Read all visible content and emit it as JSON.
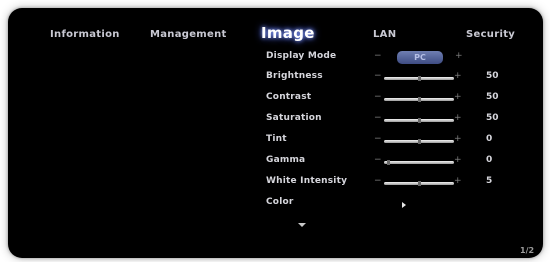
{
  "tabs": [
    {
      "label": "Information"
    },
    {
      "label": "Management"
    },
    {
      "label": "Image"
    },
    {
      "label": "LAN"
    },
    {
      "label": "Security"
    }
  ],
  "active_tab": "Image",
  "rows": {
    "display_mode": {
      "label": "Display Mode",
      "minus": "−",
      "plus": "+",
      "value": "PC"
    },
    "brightness": {
      "label": "Brightness",
      "minus": "−",
      "plus": "+",
      "value": "50",
      "level": 0.5
    },
    "contrast": {
      "label": "Contrast",
      "minus": "−",
      "plus": "+",
      "value": "50",
      "level": 0.5
    },
    "saturation": {
      "label": "Saturation",
      "minus": "−",
      "plus": "+",
      "value": "50",
      "level": 0.5
    },
    "tint": {
      "label": "Tint",
      "minus": "−",
      "plus": "+",
      "value": "0",
      "level": 0.5
    },
    "gamma": {
      "label": "Gamma",
      "minus": "−",
      "plus": "+",
      "value": "0",
      "level": 0.05
    },
    "white_intensity": {
      "label": "White Intensity",
      "minus": "−",
      "plus": "+",
      "value": "5",
      "level": 0.5
    },
    "color": {
      "label": "Color"
    }
  },
  "page_indicator": "1/2",
  "colors": {
    "background": "#000000",
    "active_glow": "#4a64ff",
    "mode_button": "#4e5d96"
  }
}
